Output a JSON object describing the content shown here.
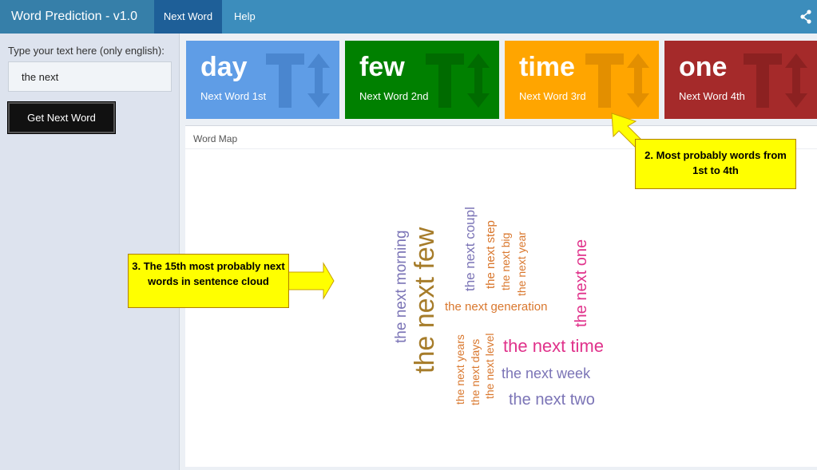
{
  "app": {
    "title": "Word Prediction - v1.0"
  },
  "nav": {
    "tabs": [
      {
        "label": "Next Word"
      },
      {
        "label": "Help"
      }
    ]
  },
  "sidebar": {
    "input_label": "Type your text here (only english):",
    "input_value": "the next",
    "button_label": "Get Next Word"
  },
  "predictions": [
    {
      "word": "day",
      "label": "Next Word 1st",
      "color": "#5f9de6",
      "icon_color": "#4a86cf"
    },
    {
      "word": "few",
      "label": "Next Word 2nd",
      "color": "#008000",
      "icon_color": "#006b00"
    },
    {
      "word": "time",
      "label": "Next Word 3rd",
      "color": "#ffa500",
      "icon_color": "#e38f00"
    },
    {
      "word": "one",
      "label": "Next Word 4th",
      "color": "#a52a2a",
      "icon_color": "#8c2121"
    }
  ],
  "word_map": {
    "title": "Word Map",
    "words": [
      "the next few",
      "the next morning",
      "the next coupl",
      "the next step",
      "the next big",
      "the next year",
      "the next one",
      "the next generation",
      "the next years",
      "the next days",
      "the next level",
      "the next time",
      "the next week",
      "the next two"
    ]
  },
  "annotations": {
    "top_callout": "2. Most probably words from 1st to 4th",
    "left_callout": "3. The 15th most probably next words in sentence cloud"
  },
  "icons": {
    "share": "share-icon",
    "prediction": "text-height-icon"
  }
}
